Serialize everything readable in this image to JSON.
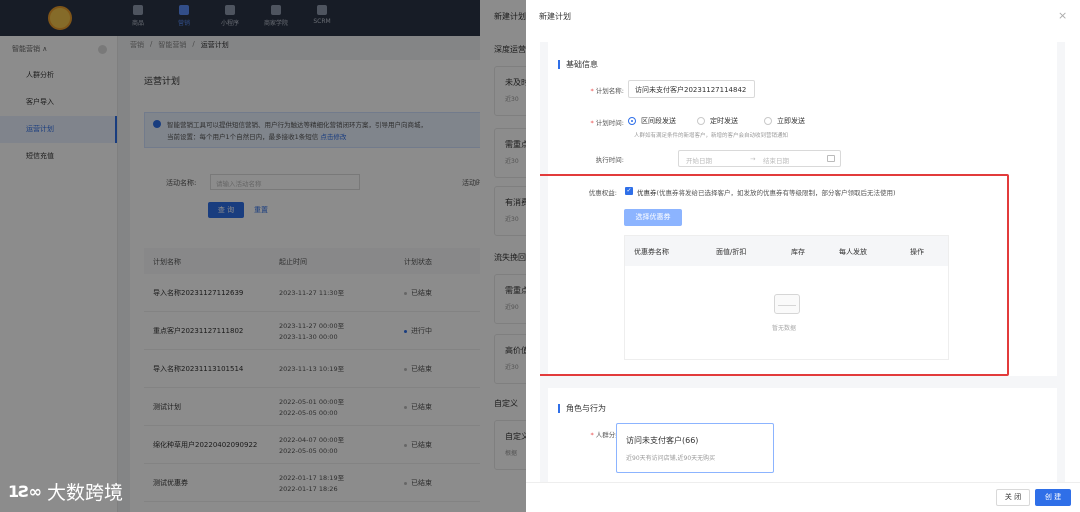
{
  "topnav": [
    {
      "label": "商品",
      "active": false
    },
    {
      "label": "营销",
      "active": true
    },
    {
      "label": "小程序",
      "active": false
    },
    {
      "label": "商家学院",
      "active": false
    },
    {
      "label": "SCRM",
      "active": false
    }
  ],
  "leftnav": {
    "header": "智能营销 ∧",
    "items": [
      {
        "label": "人群分析",
        "active": false
      },
      {
        "label": "客户导入",
        "active": false
      },
      {
        "label": "运营计划",
        "active": true
      },
      {
        "label": "短信充值",
        "active": false
      }
    ]
  },
  "breadcrumb": [
    "营销",
    "/",
    "智能营销",
    "/",
    "运营计划"
  ],
  "main": {
    "title": "运营计划",
    "tip_line1": "智能营销工具可以提供短信营销、用户行为触达等精细化营销闭环方案，引导用户向商城，",
    "tip_line2": "当前设置：每个用户1个自然日内，最多接收1条短信",
    "tip_link": "点击修改",
    "search_label": "活动名称:",
    "search_placeholder": "请输入活动名称",
    "search_label2": "活动时",
    "query_button": "查 询",
    "reset_button": "重置",
    "table_headers": [
      "计划名称",
      "起止时间",
      "计划状态"
    ],
    "rows": [
      {
        "name": "导入名称20231127112639",
        "time1": "2023-11-27 11:30至",
        "time2": "",
        "status": "已结束",
        "active": false
      },
      {
        "name": "重点客户20231127111802",
        "time1": "2023-11-27 00:00至",
        "time2": "2023-11-30 00:00",
        "status": "进行中",
        "active": true
      },
      {
        "name": "导入名称20231113101514",
        "time1": "2023-11-13 10:19至",
        "time2": "",
        "status": "已结束",
        "active": false
      },
      {
        "name": "测试计划",
        "time1": "2022-05-01 00:00至",
        "time2": "2022-05-05 00:00",
        "status": "已结束",
        "active": false
      },
      {
        "name": "绵化种草用户20220402090922",
        "time1": "2022-04-07 00:00至",
        "time2": "2022-05-05 00:00",
        "status": "已结束",
        "active": false
      },
      {
        "name": "测试优惠券",
        "time1": "2022-01-17 18:19至",
        "time2": "2022-01-17 18:26",
        "status": "已结束",
        "active": false
      }
    ]
  },
  "drawer_back": {
    "title": "新建计划",
    "section1": "深度运营",
    "section2": "流失挽回",
    "section3": "自定义",
    "cards": [
      {
        "title": "未及时",
        "sub": "近30"
      },
      {
        "title": "需重点",
        "sub": "近30"
      },
      {
        "title": "有消费",
        "sub": "近30"
      },
      {
        "title": "需重点",
        "sub": "近90"
      },
      {
        "title": "高价值",
        "sub": "近30"
      },
      {
        "title": "自定义",
        "sub": "根据"
      }
    ]
  },
  "watermark": {
    "mark": "1Ƨ∞",
    "text": "大数跨境"
  },
  "drawer": {
    "title": "新建计划",
    "close_icon": "×",
    "basic_section": "基础信息",
    "plan_name_label": "计划名称:",
    "plan_name_value": "访问未支付客户20231127114842",
    "plan_time_label": "计划时间:",
    "radios": [
      {
        "label": "区间段发送",
        "checked": true
      },
      {
        "label": "定时发送",
        "checked": false
      },
      {
        "label": "立即发送",
        "checked": false
      }
    ],
    "radio_hint": "人群如有满足条件的新增客户，新增的客户会自动收到营销通知",
    "exec_time_label": "执行时间:",
    "start_placeholder": "开始日期",
    "range_arrow": "→",
    "end_placeholder": "结束日期",
    "coupon_label": "优惠权益:",
    "coupon_checkbox": "优惠券",
    "coupon_note": "(优惠券将发给已选择客户，如发放的优惠券有等级限制，部分客户领取后无法使用)",
    "select_coupon_button": "选择优惠券",
    "coupon_table_headers": [
      "优惠券名称",
      "面值/折扣",
      "库存",
      "每人发放",
      "操作"
    ],
    "empty_text": "暂无数据",
    "role_section": "角色与行为",
    "crowd_label": "人群分类:",
    "crowd_title": "访问未支付客户(66)",
    "crowd_desc": "近90天有访问店铺,近90天无购买",
    "close_button": "关 闭",
    "create_button": "创 建"
  }
}
